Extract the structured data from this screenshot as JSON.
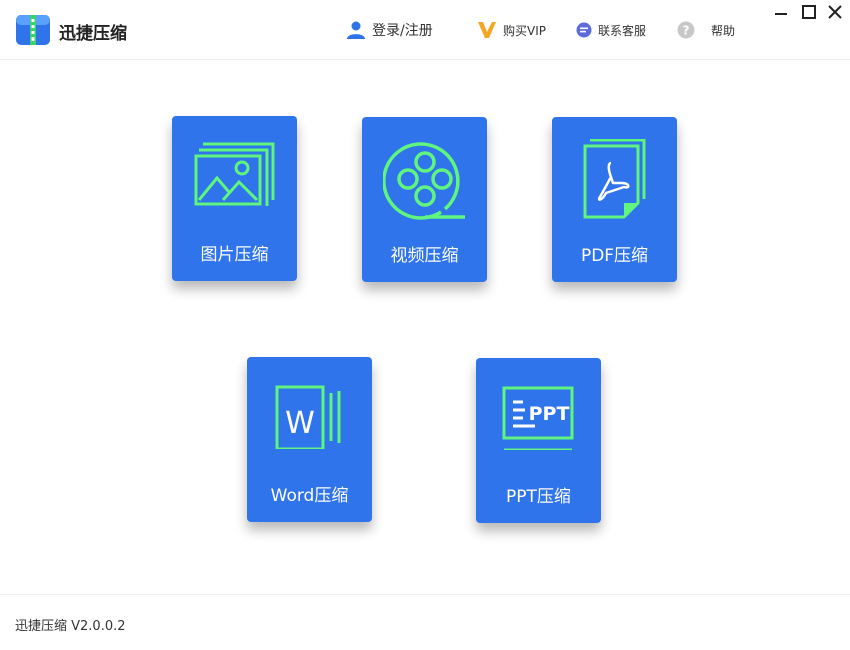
{
  "app": {
    "title": "迅捷压缩",
    "version": "迅捷压缩 V2.0.0.2",
    "accent_color": "#2f74eb",
    "icon_line_color": "#5ff57e"
  },
  "nav": {
    "login": "登录/注册",
    "vip": "购买VIP",
    "service": "联系客服",
    "help": "帮助"
  },
  "tiles": [
    {
      "label": "图片压缩",
      "icon": "image-icon"
    },
    {
      "label": "视频压缩",
      "icon": "film-reel-icon"
    },
    {
      "label": "PDF压缩",
      "icon": "pdf-icon"
    },
    {
      "label": "Word压缩",
      "icon": "word-icon"
    },
    {
      "label": "PPT压缩",
      "icon": "ppt-icon"
    }
  ],
  "icons": {
    "word_letter": "W",
    "ppt_text": "PPT"
  }
}
